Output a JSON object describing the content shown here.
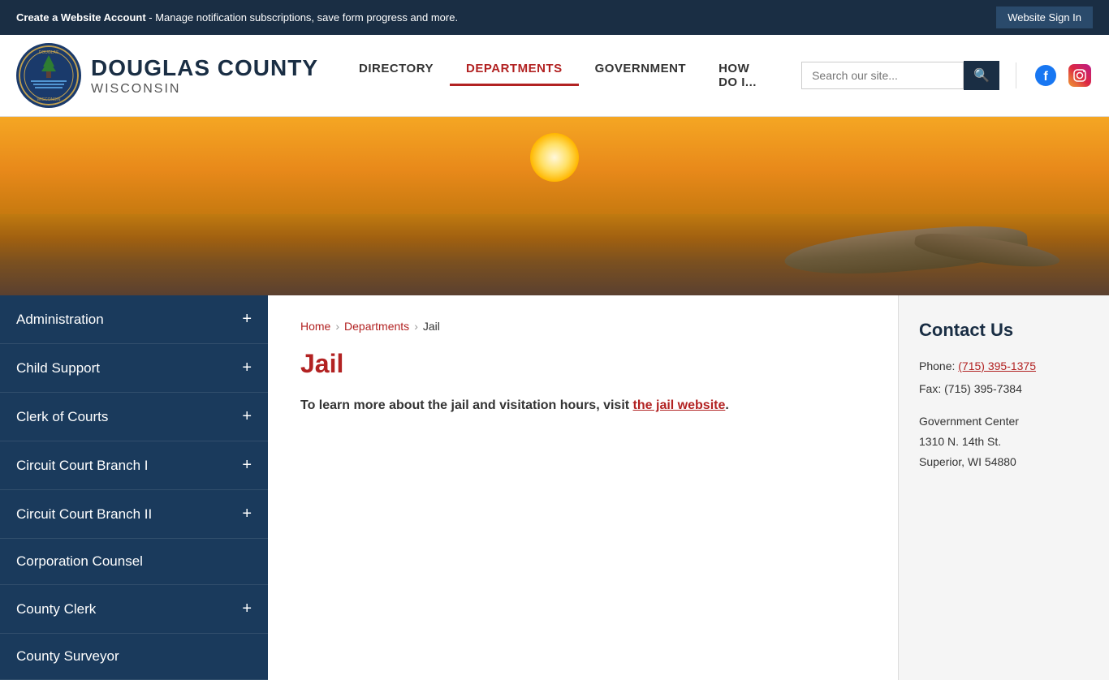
{
  "top_banner": {
    "text_prefix": "Create a Website Account",
    "text_suffix": " - Manage notification subscriptions, save form progress and more.",
    "sign_in_label": "Website Sign In"
  },
  "header": {
    "county_name": "DOUGLAS COUNTY",
    "state_name": "WISCONSIN",
    "nav_items": [
      {
        "label": "DIRECTORY",
        "active": false
      },
      {
        "label": "DEPARTMENTS",
        "active": true
      },
      {
        "label": "GOVERNMENT",
        "active": false
      },
      {
        "label": "HOW DO I...",
        "active": false
      }
    ],
    "search_placeholder": "Search our site..."
  },
  "sidebar": {
    "items": [
      {
        "label": "Administration",
        "has_plus": true
      },
      {
        "label": "Child Support",
        "has_plus": true
      },
      {
        "label": "Clerk of Courts",
        "has_plus": true
      },
      {
        "label": "Circuit Court Branch I",
        "has_plus": true
      },
      {
        "label": "Circuit Court Branch II",
        "has_plus": true
      },
      {
        "label": "Corporation Counsel",
        "has_plus": false
      },
      {
        "label": "County Clerk",
        "has_plus": true
      },
      {
        "label": "County Surveyor",
        "has_plus": false
      }
    ]
  },
  "breadcrumb": {
    "home": "Home",
    "departments": "Departments",
    "current": "Jail"
  },
  "main": {
    "page_title": "Jail",
    "description_text": "To learn more about the jail and visitation hours, visit ",
    "link_text": "the jail website",
    "description_end": "."
  },
  "contact": {
    "title": "Contact Us",
    "phone_label": "Phone:",
    "phone_number": "(715) 395-1375",
    "fax_label": "Fax:",
    "fax_number": "(715) 395-7384",
    "address_line1": "Government Center",
    "address_line2": "1310 N. 14th St.",
    "address_line3": "Superior, WI 54880"
  }
}
